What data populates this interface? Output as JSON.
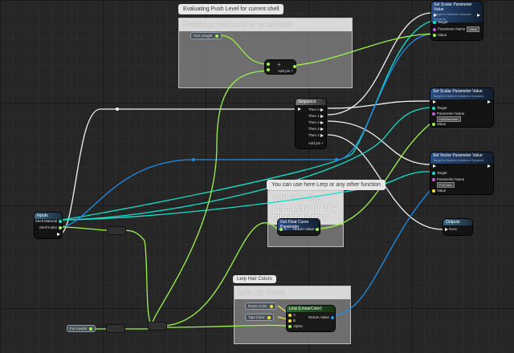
{
  "comments": {
    "push_level": {
      "bubble": "Evaluating Push Level for current shell",
      "title": "Evaluating Push Level for current shell"
    },
    "lerp_note": {
      "bubble": "You can use here Lerp or any other function",
      "title": "You can use here Lerp or any other function"
    },
    "lerp_hair": {
      "bubble": "Lerp Hair Colors",
      "title": "Lerp Hair Colors"
    }
  },
  "nodes": {
    "hair_length": {
      "label": "Hair Length"
    },
    "add": {
      "symbol": "+",
      "add_pin": "Add pin +"
    },
    "set_scalar_1": {
      "title": "Set Scalar Parameter Value",
      "subtitle": "Target is Material Instance Dynamic",
      "target": "Target",
      "param_name": "Parameter Name",
      "param_value": "Offset",
      "value": "Value"
    },
    "sequence": {
      "title": "Sequence",
      "then": [
        "Then 0",
        "Then 1",
        "Then 2",
        "Then 3",
        "Then 4"
      ],
      "add_pin": "Add pin +"
    },
    "set_scalar_2": {
      "title": "Set Scalar Parameter Value",
      "subtitle": "Target is Material Instance Dynamic",
      "target": "Target",
      "param_name": "Parameter Name",
      "param_value": "HairDiameter",
      "value": "Value"
    },
    "set_vector": {
      "title": "Set Vector Parameter Value",
      "subtitle": "Target is Material Instance Dynamic",
      "target": "Target",
      "param_name": "Parameter Name",
      "param_value": "FurColor",
      "value": "Value"
    },
    "inputs": {
      "title": "Inputs",
      "shell_material": "Shell Material",
      "shell_index": "Shell Index"
    },
    "outputs": {
      "title": "Outputs",
      "exec": "Exec"
    },
    "curve_param": {
      "title": "Get Float Curve Parameter",
      "a": "A",
      "return": "Return Value"
    },
    "fur_levels": {
      "label": "Fur Levels"
    },
    "roots_color": {
      "label": "Roots Color"
    },
    "tips_color": {
      "label": "Tips Color"
    },
    "lerp": {
      "title": "Lerp (LinearColor)",
      "a": "A",
      "b": "B",
      "alpha": "Alpha",
      "return": "Return Value"
    }
  },
  "colors": {
    "exec": "#ffffff",
    "object": "#16e0c8",
    "struct": "#1d8ee8",
    "float": "#9cf34c",
    "linear_color": "#f2e13a"
  }
}
